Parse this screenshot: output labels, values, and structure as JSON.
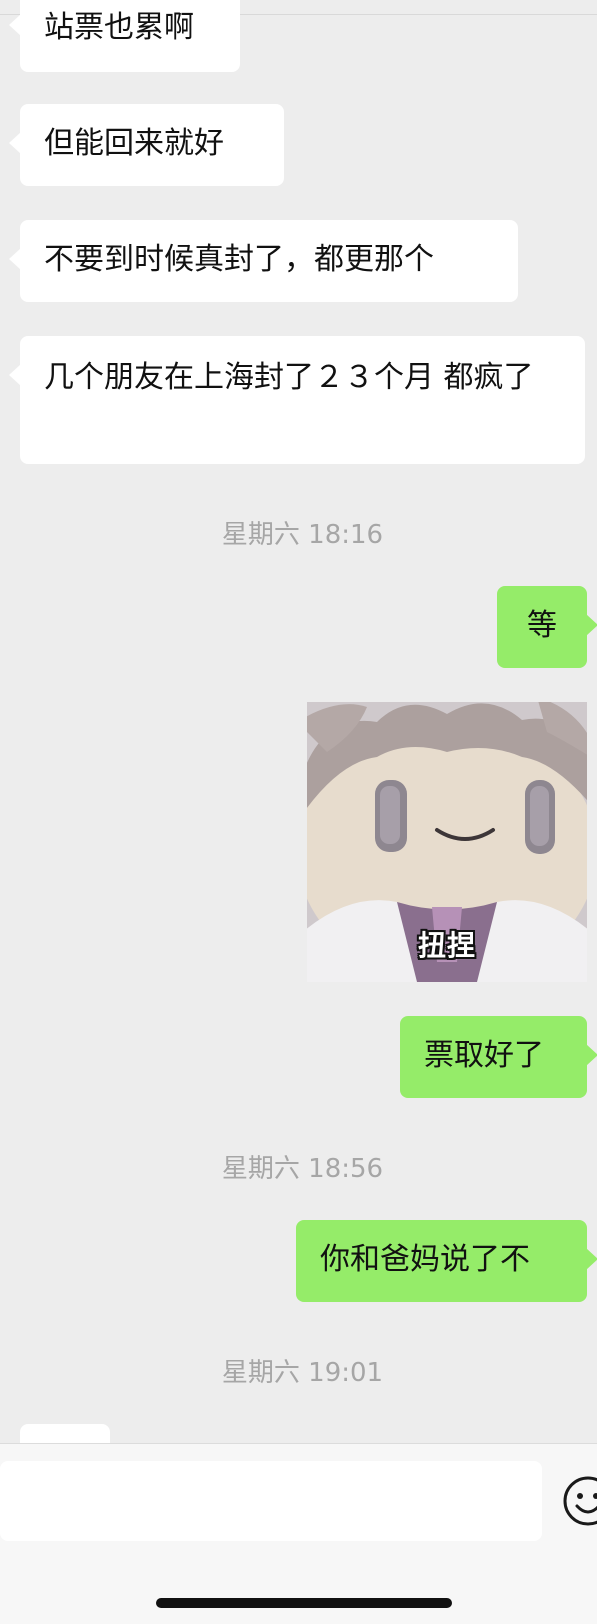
{
  "messages": [
    {
      "type": "received",
      "text": "站票也累啊"
    },
    {
      "type": "received",
      "text": "但能回来就好"
    },
    {
      "type": "received",
      "text": "不要到时候真封了，都更那个"
    },
    {
      "type": "received",
      "text": "几个朋友在上海封了２３个月 都疯了"
    },
    {
      "type": "timestamp",
      "text": "星期六 18:16"
    },
    {
      "type": "sent",
      "text": "等"
    },
    {
      "type": "sticker",
      "caption": "扭捏",
      "icon": "plush-doll-sticker"
    },
    {
      "type": "sent",
      "text": "票取好了"
    },
    {
      "type": "timestamp",
      "text": "星期六 18:56"
    },
    {
      "type": "sent",
      "text": "你和爸妈说了不"
    },
    {
      "type": "timestamp",
      "text": "星期六 19:01"
    },
    {
      "type": "received",
      "text": ""
    }
  ],
  "input_bar": {
    "input_value": "",
    "emoji_icon": "emoji-smile-icon"
  },
  "colors": {
    "background": "#ededed",
    "sent_bubble": "#95ec69",
    "received_bubble": "#ffffff",
    "timestamp_text": "#a6a6a6"
  }
}
